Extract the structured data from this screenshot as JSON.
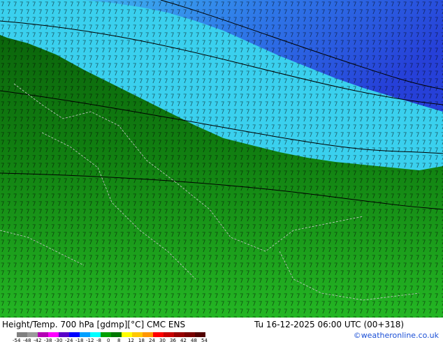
{
  "footer": {
    "title": "Height/Temp. 700 hPa [gdmp][°C] CMC ENS",
    "datetime": "Tu 16-12-2025 06:00 UTC (00+318)",
    "credit": "©weatheronline.co.uk"
  },
  "colorbar": {
    "ticks": [
      "-54",
      "-48",
      "-42",
      "-38",
      "-30",
      "-24",
      "-18",
      "-12",
      "-8",
      "0",
      "8",
      "12",
      "18",
      "24",
      "30",
      "36",
      "42",
      "48",
      "54"
    ],
    "colors": [
      "#808080",
      "#9a9a9a",
      "#b400b4",
      "#ff00ff",
      "#5a00c8",
      "#0000ff",
      "#00a0ff",
      "#00ffff",
      "#00a000",
      "#007800",
      "#ffff00",
      "#ffc800",
      "#ff9600",
      "#ff0000",
      "#c80000",
      "#960000",
      "#780000",
      "#500000"
    ]
  },
  "map": {
    "colors": {
      "blue": "#2a5ae6",
      "cyan": "#3ad0ee",
      "green_dark": "#0a6e0a",
      "green_mid": "#148c14",
      "green_light": "#22b822",
      "contour": "#000000",
      "border": "#c8c8c8"
    }
  }
}
